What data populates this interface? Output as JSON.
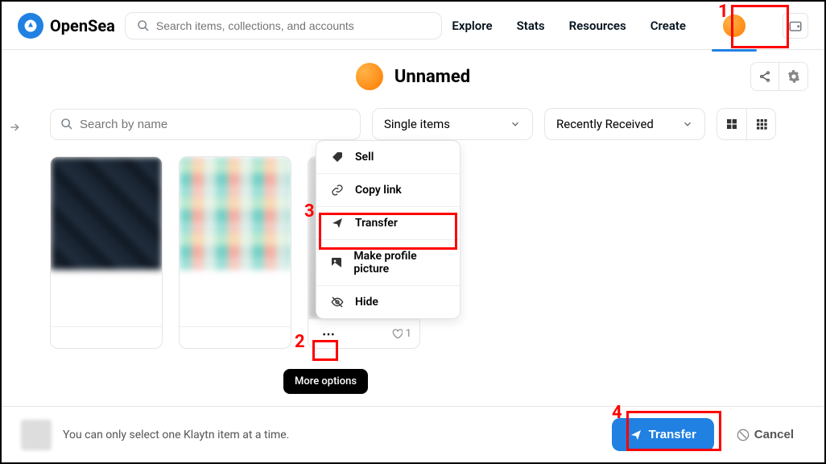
{
  "header": {
    "brand": "OpenSea",
    "search_placeholder": "Search items, collections, and accounts",
    "nav": [
      "Explore",
      "Stats",
      "Resources",
      "Create"
    ]
  },
  "profile": {
    "name": "Unnamed"
  },
  "toolbar": {
    "search_placeholder": "Search by name",
    "filter1": "Single items",
    "filter2": "Recently Received"
  },
  "menu": {
    "sell": "Sell",
    "copy": "Copy link",
    "transfer": "Transfer",
    "make_pic": "Make profile picture",
    "hide": "Hide"
  },
  "card3": {
    "likes": "1"
  },
  "tooltip": "More options",
  "footer": {
    "message": "You can only select one Klaytn item at a time.",
    "transfer": "Transfer",
    "cancel": "Cancel"
  },
  "annotations": {
    "n1": "1",
    "n2": "2",
    "n3": "3",
    "n4": "4"
  }
}
